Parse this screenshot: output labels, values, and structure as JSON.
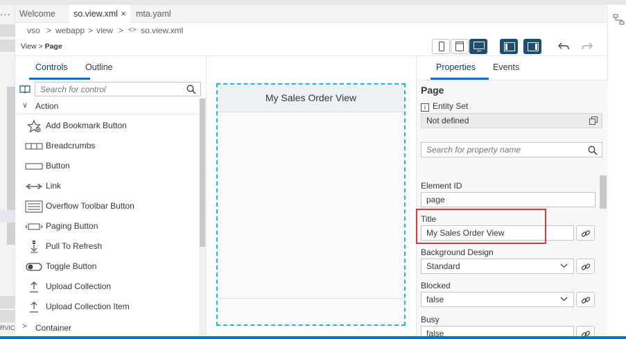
{
  "tabs": [
    {
      "label": "Welcome"
    },
    {
      "label": "so.view.xml",
      "close": "×"
    },
    {
      "label": "mta.yaml"
    }
  ],
  "more_glyph": "···",
  "breadcrumb": [
    "vso",
    "webapp",
    "view",
    "so.view.xml"
  ],
  "breadcrumb_sep": ">",
  "breadcrumb_file_glyph": "<>",
  "editor_path": {
    "parent": "View",
    "sep": ">",
    "current": "Page"
  },
  "left_panel": {
    "tabs": [
      "Controls",
      "Outline"
    ],
    "search_placeholder": "Search for control",
    "groups": [
      {
        "chevron": "∨",
        "label": "Action"
      },
      {
        "chevron": ">",
        "label": "Container"
      }
    ],
    "controls": [
      {
        "label": "Add Bookmark Button",
        "icon": "star-add-icon"
      },
      {
        "label": "Breadcrumbs",
        "icon": "breadcrumbs-icon"
      },
      {
        "label": "Button",
        "icon": "button-icon"
      },
      {
        "label": "Link",
        "icon": "link-icon"
      },
      {
        "label": "Overflow Toolbar Button",
        "icon": "overflow-toolbar-icon"
      },
      {
        "label": "Paging Button",
        "icon": "paging-icon"
      },
      {
        "label": "Pull To Refresh",
        "icon": "pull-refresh-icon"
      },
      {
        "label": "Toggle Button",
        "icon": "toggle-icon"
      },
      {
        "label": "Upload Collection",
        "icon": "upload-icon"
      },
      {
        "label": "Upload Collection Item",
        "icon": "upload-icon"
      }
    ]
  },
  "canvas": {
    "page_title": "My Sales Order View"
  },
  "right_panel": {
    "tabs": [
      "Properties",
      "Events"
    ],
    "control_name": "Page",
    "entity_set_label": "Entity Set",
    "entity_set_value": "Not defined",
    "search_placeholder": "Search for property name",
    "fields": {
      "element_id": {
        "label": "Element ID",
        "value": "page"
      },
      "title": {
        "label": "Title",
        "value": "My Sales Order View"
      },
      "background_design": {
        "label": "Background Design",
        "value": "Standard"
      },
      "blocked": {
        "label": "Blocked",
        "value": "false"
      },
      "busy": {
        "label": "Busy",
        "value": "false"
      }
    }
  },
  "activity_label": "RVICE",
  "colors": {
    "accent": "#0a6ed1",
    "selected_frame": "#1ab6e8",
    "highlight": "#e0373b",
    "device_active": "#1d4f76"
  }
}
